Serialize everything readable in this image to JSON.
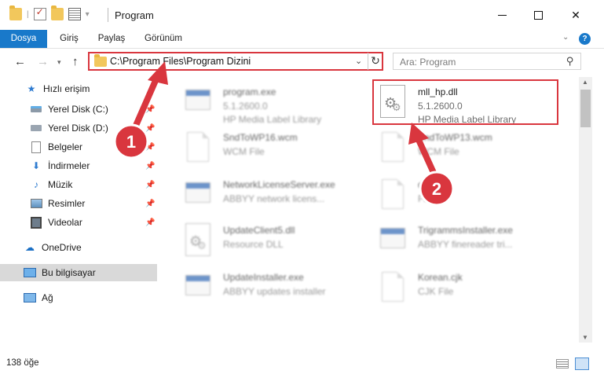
{
  "window": {
    "title": "Program"
  },
  "ribbon": {
    "tabs": [
      "Dosya",
      "Giriş",
      "Paylaş",
      "Görünüm"
    ],
    "help": "?"
  },
  "navigation": {
    "address_path": "C:\\Program Files\\Program Dizini",
    "search_placeholder": "Ara: Program"
  },
  "sidebar": {
    "items": [
      {
        "label": "Hızlı erişim",
        "icon": "star-icon",
        "pinned": false
      },
      {
        "label": "Yerel Disk (C:)",
        "icon": "disk-c-icon",
        "pinned": true
      },
      {
        "label": "Yerel Disk (D:)",
        "icon": "disk-d-icon",
        "pinned": true
      },
      {
        "label": "Belgeler",
        "icon": "documents-icon",
        "pinned": true
      },
      {
        "label": "İndirmeler",
        "icon": "downloads-icon",
        "pinned": true
      },
      {
        "label": "Müzik",
        "icon": "music-icon",
        "pinned": true
      },
      {
        "label": "Resimler",
        "icon": "pictures-icon",
        "pinned": true
      },
      {
        "label": "Videolar",
        "icon": "videos-icon",
        "pinned": true
      },
      {
        "label": "OneDrive",
        "icon": "onedrive-icon",
        "pinned": false
      },
      {
        "label": "Bu bilgisayar",
        "icon": "computer-icon",
        "pinned": false,
        "selected": true
      },
      {
        "label": "Ağ",
        "icon": "network-icon",
        "pinned": false
      }
    ]
  },
  "files": [
    {
      "name": "program.exe",
      "line2": "5.1.2600.0",
      "line3": "HP Media Label Library",
      "icon": "exe-icon",
      "blurred": true
    },
    {
      "name": "mll_hp.dll",
      "line2": "5.1.2600.0",
      "line3": "HP Media Label Library",
      "icon": "dll-gear-icon",
      "blurred": false,
      "highlighted": true
    },
    {
      "name": "SndToWP16.wcm",
      "line2": "WCM File",
      "line3": "",
      "icon": "blank-file-icon",
      "blurred": true
    },
    {
      "name": "SndToWP13.wcm",
      "line2": "WCM File",
      "line3": "",
      "icon": "blank-file-icon",
      "blurred": true
    },
    {
      "name": "NetworkLicenseServer.exe",
      "line2": "ABBYY network licens...",
      "line3": "",
      "icon": "exe-icon",
      "blurred": true
    },
    {
      "name": "dll",
      "line2": "File",
      "line3": "",
      "icon": "blank-file-icon",
      "blurred": true
    },
    {
      "name": "UpdateClient5.dll",
      "line2": "Resource DLL",
      "line3": "",
      "icon": "dll-gear-icon",
      "blurred": true
    },
    {
      "name": "TrigrammsInstaller.exe",
      "line2": "ABBYY finereader tri...",
      "line3": "",
      "icon": "exe-icon",
      "blurred": true
    },
    {
      "name": "UpdateInstaller.exe",
      "line2": "ABBYY updates installer",
      "line3": "",
      "icon": "exe-icon",
      "blurred": true
    },
    {
      "name": "Korean.cjk",
      "line2": "CJK File",
      "line3": "",
      "icon": "blank-file-icon",
      "blurred": true
    }
  ],
  "status": {
    "item_count": "138 öğe"
  },
  "annotations": {
    "step1": "1",
    "step2": "2"
  },
  "colors": {
    "accent": "#1979ca",
    "annotation_red": "#d9363e",
    "selected_bg": "#d9d9d9"
  }
}
